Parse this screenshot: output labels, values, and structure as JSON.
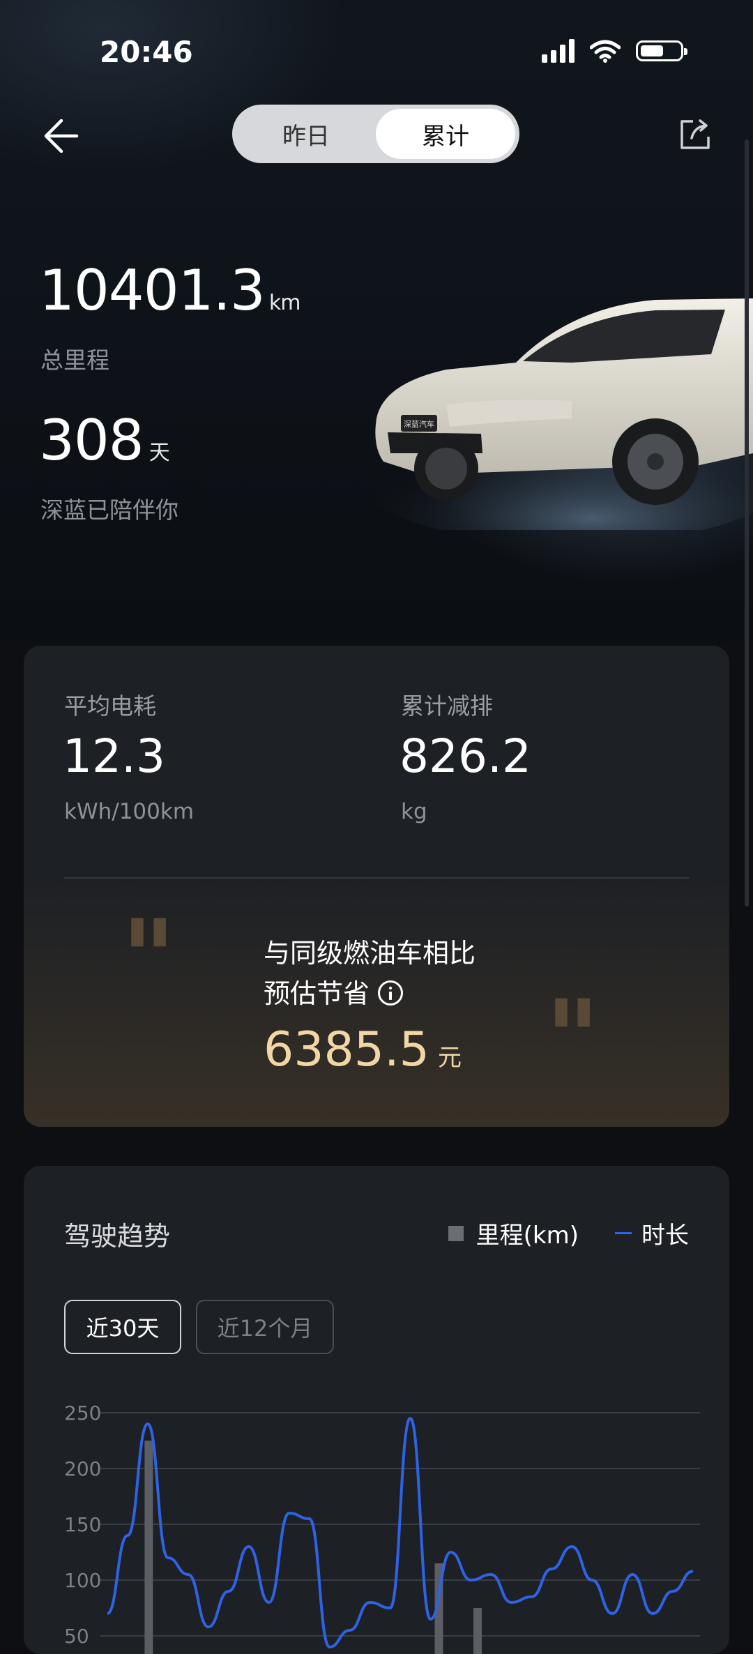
{
  "status_bar": {
    "time": "20:46"
  },
  "header": {
    "tabs": [
      {
        "label": "昨日",
        "active": false
      },
      {
        "label": "累计",
        "active": true
      }
    ]
  },
  "summary": {
    "total_mileage": "10401.3",
    "total_mileage_unit": "km",
    "total_mileage_label": "总里程",
    "days": "308",
    "days_unit": "天",
    "days_label": "深蓝已陪伴你"
  },
  "car": {
    "plate_text": "深蓝汽车"
  },
  "efficiency": {
    "avg_label": "平均电耗",
    "avg_value": "12.3",
    "avg_unit": "kWh/100km",
    "emission_label": "累计减排",
    "emission_value": "826.2",
    "emission_unit": "kg",
    "compare_line1": "与同级燃油车相比",
    "compare_line2": "预估节省",
    "saving_value": "6385.5",
    "saving_unit": "元"
  },
  "trend": {
    "title": "驾驶趋势",
    "legend_mileage": "里程(km)",
    "legend_duration": "时长",
    "range_tabs": [
      {
        "label": "近30天",
        "active": true
      },
      {
        "label": "近12个月",
        "active": false
      }
    ]
  },
  "colors": {
    "accent_line": "#2f63e6",
    "bar": "#5b5e64",
    "saving": "#f3d6a6"
  },
  "chart_data": {
    "type": "bar",
    "y_ticks": [
      "250",
      "200",
      "150",
      "100",
      "50"
    ],
    "ylim": [
      0,
      250
    ],
    "grid": true,
    "series": [
      {
        "name": "里程(km)",
        "type": "bar",
        "values": [
          0,
          0,
          225,
          3,
          0,
          0,
          0,
          0,
          4,
          0,
          10,
          8,
          0,
          0,
          0,
          0,
          0,
          115,
          0,
          75,
          0,
          0,
          0,
          0,
          4,
          0,
          0,
          4,
          3,
          0,
          0
        ]
      },
      {
        "name": "时长",
        "type": "line",
        "values": [
          70,
          140,
          240,
          120,
          105,
          58,
          90,
          130,
          80,
          160,
          155,
          40,
          55,
          80,
          75,
          245,
          65,
          125,
          100,
          105,
          80,
          85,
          110,
          130,
          100,
          70,
          105,
          70,
          90,
          108
        ]
      }
    ]
  }
}
